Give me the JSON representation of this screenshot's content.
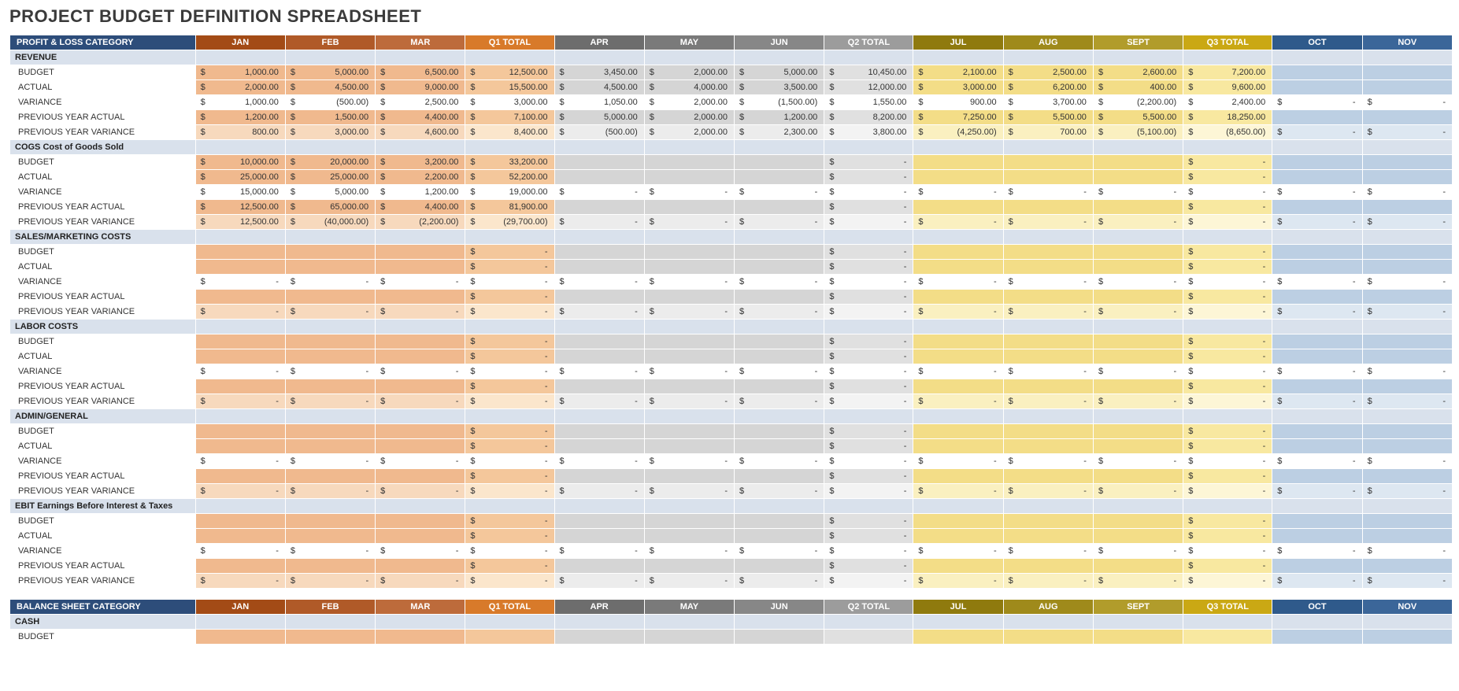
{
  "title": "PROJECT BUDGET DEFINITION SPREADSHEET",
  "columns": [
    {
      "key": "cat",
      "label": "PROFIT & LOSS CATEGORY",
      "hdr": "hdr-cat"
    },
    {
      "key": "jan",
      "label": "JAN",
      "hdr": "hdr-jan",
      "group": "q1"
    },
    {
      "key": "feb",
      "label": "FEB",
      "hdr": "hdr-feb",
      "group": "q1"
    },
    {
      "key": "mar",
      "label": "MAR",
      "hdr": "hdr-mar",
      "group": "q1"
    },
    {
      "key": "q1",
      "label": "Q1 TOTAL",
      "hdr": "hdr-q1",
      "group": "q1t"
    },
    {
      "key": "apr",
      "label": "APR",
      "hdr": "hdr-apr",
      "group": "q2"
    },
    {
      "key": "may",
      "label": "MAY",
      "hdr": "hdr-may",
      "group": "q2"
    },
    {
      "key": "jun",
      "label": "JUN",
      "hdr": "hdr-jun",
      "group": "q2"
    },
    {
      "key": "q2",
      "label": "Q2 TOTAL",
      "hdr": "hdr-q2",
      "group": "q2t"
    },
    {
      "key": "jul",
      "label": "JUL",
      "hdr": "hdr-jul",
      "group": "q3"
    },
    {
      "key": "aug",
      "label": "AUG",
      "hdr": "hdr-aug",
      "group": "q3"
    },
    {
      "key": "sept",
      "label": "SEPT",
      "hdr": "hdr-sept",
      "group": "q3"
    },
    {
      "key": "q3",
      "label": "Q3 TOTAL",
      "hdr": "hdr-q3",
      "group": "q3t"
    },
    {
      "key": "oct",
      "label": "OCT",
      "hdr": "hdr-oct",
      "group": "q4"
    },
    {
      "key": "nov",
      "label": "NOV",
      "hdr": "hdr-nov",
      "group": "q4"
    }
  ],
  "balanceHeader": "BALANCE SHEET CATEGORY",
  "sections": [
    {
      "name": "REVENUE",
      "rows": [
        {
          "label": "BUDGET",
          "shade": "dark",
          "vals": {
            "jan": "1,000.00",
            "feb": "5,000.00",
            "mar": "6,500.00",
            "q1": "12,500.00",
            "apr": "3,450.00",
            "may": "2,000.00",
            "jun": "5,000.00",
            "q2": "10,450.00",
            "jul": "2,100.00",
            "aug": "2,500.00",
            "sept": "2,600.00",
            "q3": "7,200.00"
          }
        },
        {
          "label": "ACTUAL",
          "shade": "dark",
          "vals": {
            "jan": "2,000.00",
            "feb": "4,500.00",
            "mar": "9,000.00",
            "q1": "15,500.00",
            "apr": "4,500.00",
            "may": "4,000.00",
            "jun": "3,500.00",
            "q2": "12,000.00",
            "jul": "3,000.00",
            "aug": "6,200.00",
            "sept": "400.00",
            "q3": "9,600.00"
          }
        },
        {
          "label": "VARIANCE",
          "shade": "white",
          "vals": {
            "jan": "1,000.00",
            "feb": "(500.00)",
            "mar": "2,500.00",
            "q1": "3,000.00",
            "apr": "1,050.00",
            "may": "2,000.00",
            "jun": "(1,500.00)",
            "q2": "1,550.00",
            "jul": "900.00",
            "aug": "3,700.00",
            "sept": "(2,200.00)",
            "q3": "2,400.00",
            "oct": "-",
            "nov": "-"
          }
        },
        {
          "label": "PREVIOUS YEAR ACTUAL",
          "shade": "dark",
          "vals": {
            "jan": "1,200.00",
            "feb": "1,500.00",
            "mar": "4,400.00",
            "q1": "7,100.00",
            "apr": "5,000.00",
            "may": "2,000.00",
            "jun": "1,200.00",
            "q2": "8,200.00",
            "jul": "7,250.00",
            "aug": "5,500.00",
            "sept": "5,500.00",
            "q3": "18,250.00"
          }
        },
        {
          "label": "PREVIOUS YEAR VARIANCE",
          "shade": "light",
          "vals": {
            "jan": "800.00",
            "feb": "3,000.00",
            "mar": "4,600.00",
            "q1": "8,400.00",
            "apr": "(500.00)",
            "may": "2,000.00",
            "jun": "2,300.00",
            "q2": "3,800.00",
            "jul": "(4,250.00)",
            "aug": "700.00",
            "sept": "(5,100.00)",
            "q3": "(8,650.00)",
            "oct": "-",
            "nov": "-"
          }
        }
      ]
    },
    {
      "name": "COGS Cost of Goods Sold",
      "rows": [
        {
          "label": "BUDGET",
          "shade": "dark",
          "vals": {
            "jan": "10,000.00",
            "feb": "20,000.00",
            "mar": "3,200.00",
            "q1": "33,200.00",
            "q2": "-",
            "q3": "-"
          }
        },
        {
          "label": "ACTUAL",
          "shade": "dark",
          "vals": {
            "jan": "25,000.00",
            "feb": "25,000.00",
            "mar": "2,200.00",
            "q1": "52,200.00",
            "q2": "-",
            "q3": "-"
          }
        },
        {
          "label": "VARIANCE",
          "shade": "white",
          "vals": {
            "jan": "15,000.00",
            "feb": "5,000.00",
            "mar": "1,200.00",
            "q1": "19,000.00",
            "apr": "-",
            "may": "-",
            "jun": "-",
            "q2": "-",
            "jul": "-",
            "aug": "-",
            "sept": "-",
            "q3": "-",
            "oct": "-",
            "nov": "-"
          }
        },
        {
          "label": "PREVIOUS YEAR ACTUAL",
          "shade": "dark",
          "vals": {
            "jan": "12,500.00",
            "feb": "65,000.00",
            "mar": "4,400.00",
            "q1": "81,900.00",
            "q2": "-",
            "q3": "-"
          }
        },
        {
          "label": "PREVIOUS YEAR VARIANCE",
          "shade": "light",
          "vals": {
            "jan": "12,500.00",
            "feb": "(40,000.00)",
            "mar": "(2,200.00)",
            "q1": "(29,700.00)",
            "apr": "-",
            "may": "-",
            "jun": "-",
            "q2": "-",
            "jul": "-",
            "aug": "-",
            "sept": "-",
            "q3": "-",
            "oct": "-",
            "nov": "-"
          }
        }
      ]
    },
    {
      "name": "SALES/MARKETING COSTS",
      "rows": [
        {
          "label": "BUDGET",
          "shade": "dark",
          "vals": {
            "q1": "-",
            "q2": "-",
            "q3": "-"
          }
        },
        {
          "label": "ACTUAL",
          "shade": "dark",
          "vals": {
            "q1": "-",
            "q2": "-",
            "q3": "-"
          }
        },
        {
          "label": "VARIANCE",
          "shade": "white",
          "vals": {
            "jan": "-",
            "feb": "-",
            "mar": "-",
            "q1": "-",
            "apr": "-",
            "may": "-",
            "jun": "-",
            "q2": "-",
            "jul": "-",
            "aug": "-",
            "sept": "-",
            "q3": "-",
            "oct": "-",
            "nov": "-"
          }
        },
        {
          "label": "PREVIOUS YEAR ACTUAL",
          "shade": "dark",
          "vals": {
            "q1": "-",
            "q2": "-",
            "q3": "-"
          }
        },
        {
          "label": "PREVIOUS YEAR VARIANCE",
          "shade": "light",
          "vals": {
            "jan": "-",
            "feb": "-",
            "mar": "-",
            "q1": "-",
            "apr": "-",
            "may": "-",
            "jun": "-",
            "q2": "-",
            "jul": "-",
            "aug": "-",
            "sept": "-",
            "q3": "-",
            "oct": "-",
            "nov": "-"
          }
        }
      ]
    },
    {
      "name": "LABOR COSTS",
      "rows": [
        {
          "label": "BUDGET",
          "shade": "dark",
          "vals": {
            "q1": "-",
            "q2": "-",
            "q3": "-"
          }
        },
        {
          "label": "ACTUAL",
          "shade": "dark",
          "vals": {
            "q1": "-",
            "q2": "-",
            "q3": "-"
          }
        },
        {
          "label": "VARIANCE",
          "shade": "white",
          "vals": {
            "jan": "-",
            "feb": "-",
            "mar": "-",
            "q1": "-",
            "apr": "-",
            "may": "-",
            "jun": "-",
            "q2": "-",
            "jul": "-",
            "aug": "-",
            "sept": "-",
            "q3": "-",
            "oct": "-",
            "nov": "-"
          }
        },
        {
          "label": "PREVIOUS YEAR ACTUAL",
          "shade": "dark",
          "vals": {
            "q1": "-",
            "q2": "-",
            "q3": "-"
          }
        },
        {
          "label": "PREVIOUS YEAR VARIANCE",
          "shade": "light",
          "vals": {
            "jan": "-",
            "feb": "-",
            "mar": "-",
            "q1": "-",
            "apr": "-",
            "may": "-",
            "jun": "-",
            "q2": "-",
            "jul": "-",
            "aug": "-",
            "sept": "-",
            "q3": "-",
            "oct": "-",
            "nov": "-"
          }
        }
      ]
    },
    {
      "name": "ADMIN/GENERAL",
      "rows": [
        {
          "label": "BUDGET",
          "shade": "dark",
          "vals": {
            "q1": "-",
            "q2": "-",
            "q3": "-"
          }
        },
        {
          "label": "ACTUAL",
          "shade": "dark",
          "vals": {
            "q1": "-",
            "q2": "-",
            "q3": "-"
          }
        },
        {
          "label": "VARIANCE",
          "shade": "white",
          "vals": {
            "jan": "-",
            "feb": "-",
            "mar": "-",
            "q1": "-",
            "apr": "-",
            "may": "-",
            "jun": "-",
            "q2": "-",
            "jul": "-",
            "aug": "-",
            "sept": "-",
            "q3": "-",
            "oct": "-",
            "nov": "-"
          }
        },
        {
          "label": "PREVIOUS YEAR ACTUAL",
          "shade": "dark",
          "vals": {
            "q1": "-",
            "q2": "-",
            "q3": "-"
          }
        },
        {
          "label": "PREVIOUS YEAR VARIANCE",
          "shade": "light",
          "vals": {
            "jan": "-",
            "feb": "-",
            "mar": "-",
            "q1": "-",
            "apr": "-",
            "may": "-",
            "jun": "-",
            "q2": "-",
            "jul": "-",
            "aug": "-",
            "sept": "-",
            "q3": "-",
            "oct": "-",
            "nov": "-"
          }
        }
      ]
    },
    {
      "name": "EBIT Earnings Before Interest & Taxes",
      "rows": [
        {
          "label": "BUDGET",
          "shade": "dark",
          "vals": {
            "q1": "-",
            "q2": "-",
            "q3": "-"
          }
        },
        {
          "label": "ACTUAL",
          "shade": "dark",
          "vals": {
            "q1": "-",
            "q2": "-",
            "q3": "-"
          }
        },
        {
          "label": "VARIANCE",
          "shade": "white",
          "vals": {
            "jan": "-",
            "feb": "-",
            "mar": "-",
            "q1": "-",
            "apr": "-",
            "may": "-",
            "jun": "-",
            "q2": "-",
            "jul": "-",
            "aug": "-",
            "sept": "-",
            "q3": "-",
            "oct": "-",
            "nov": "-"
          }
        },
        {
          "label": "PREVIOUS YEAR ACTUAL",
          "shade": "dark",
          "vals": {
            "q1": "-",
            "q2": "-",
            "q3": "-"
          }
        },
        {
          "label": "PREVIOUS YEAR VARIANCE",
          "shade": "light",
          "vals": {
            "jan": "-",
            "feb": "-",
            "mar": "-",
            "q1": "-",
            "apr": "-",
            "may": "-",
            "jun": "-",
            "q2": "-",
            "jul": "-",
            "aug": "-",
            "sept": "-",
            "q3": "-",
            "oct": "-",
            "nov": "-"
          }
        }
      ]
    }
  ],
  "balanceSections": [
    {
      "name": "CASH",
      "rows": [
        {
          "label": "BUDGET",
          "shade": "dark",
          "vals": {}
        }
      ]
    }
  ]
}
